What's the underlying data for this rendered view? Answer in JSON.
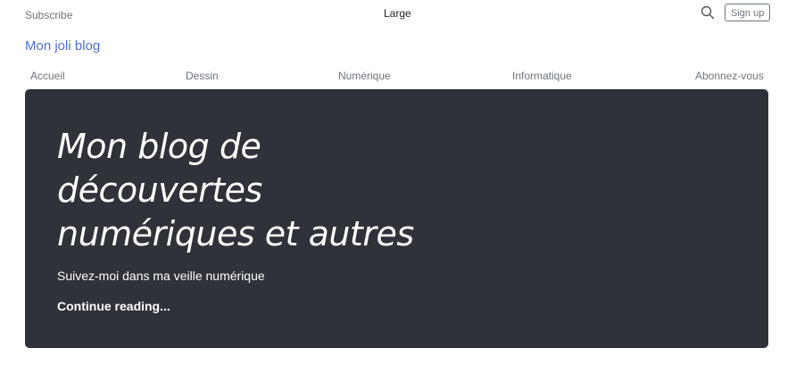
{
  "header": {
    "subscribe_label": "Subscribe",
    "center_label": "Large",
    "search_icon": "search-icon",
    "signup_label": "Sign up"
  },
  "blog": {
    "title": "Mon joli blog"
  },
  "nav": {
    "items": [
      {
        "label": "Accueil"
      },
      {
        "label": "Dessin"
      },
      {
        "label": "Numérique"
      },
      {
        "label": "Informatique"
      },
      {
        "label": "Abonnez-vous"
      }
    ]
  },
  "hero": {
    "title_line1": "Mon blog de",
    "title_line2": "découvertes",
    "title_line3": "numériques et autres",
    "lead": "Suivez-moi dans ma veille numérique",
    "link_label": "Continue reading..."
  },
  "colors": {
    "link": "#4c6fe6",
    "hero_bg": "#2f3238",
    "muted": "#6c757d"
  }
}
